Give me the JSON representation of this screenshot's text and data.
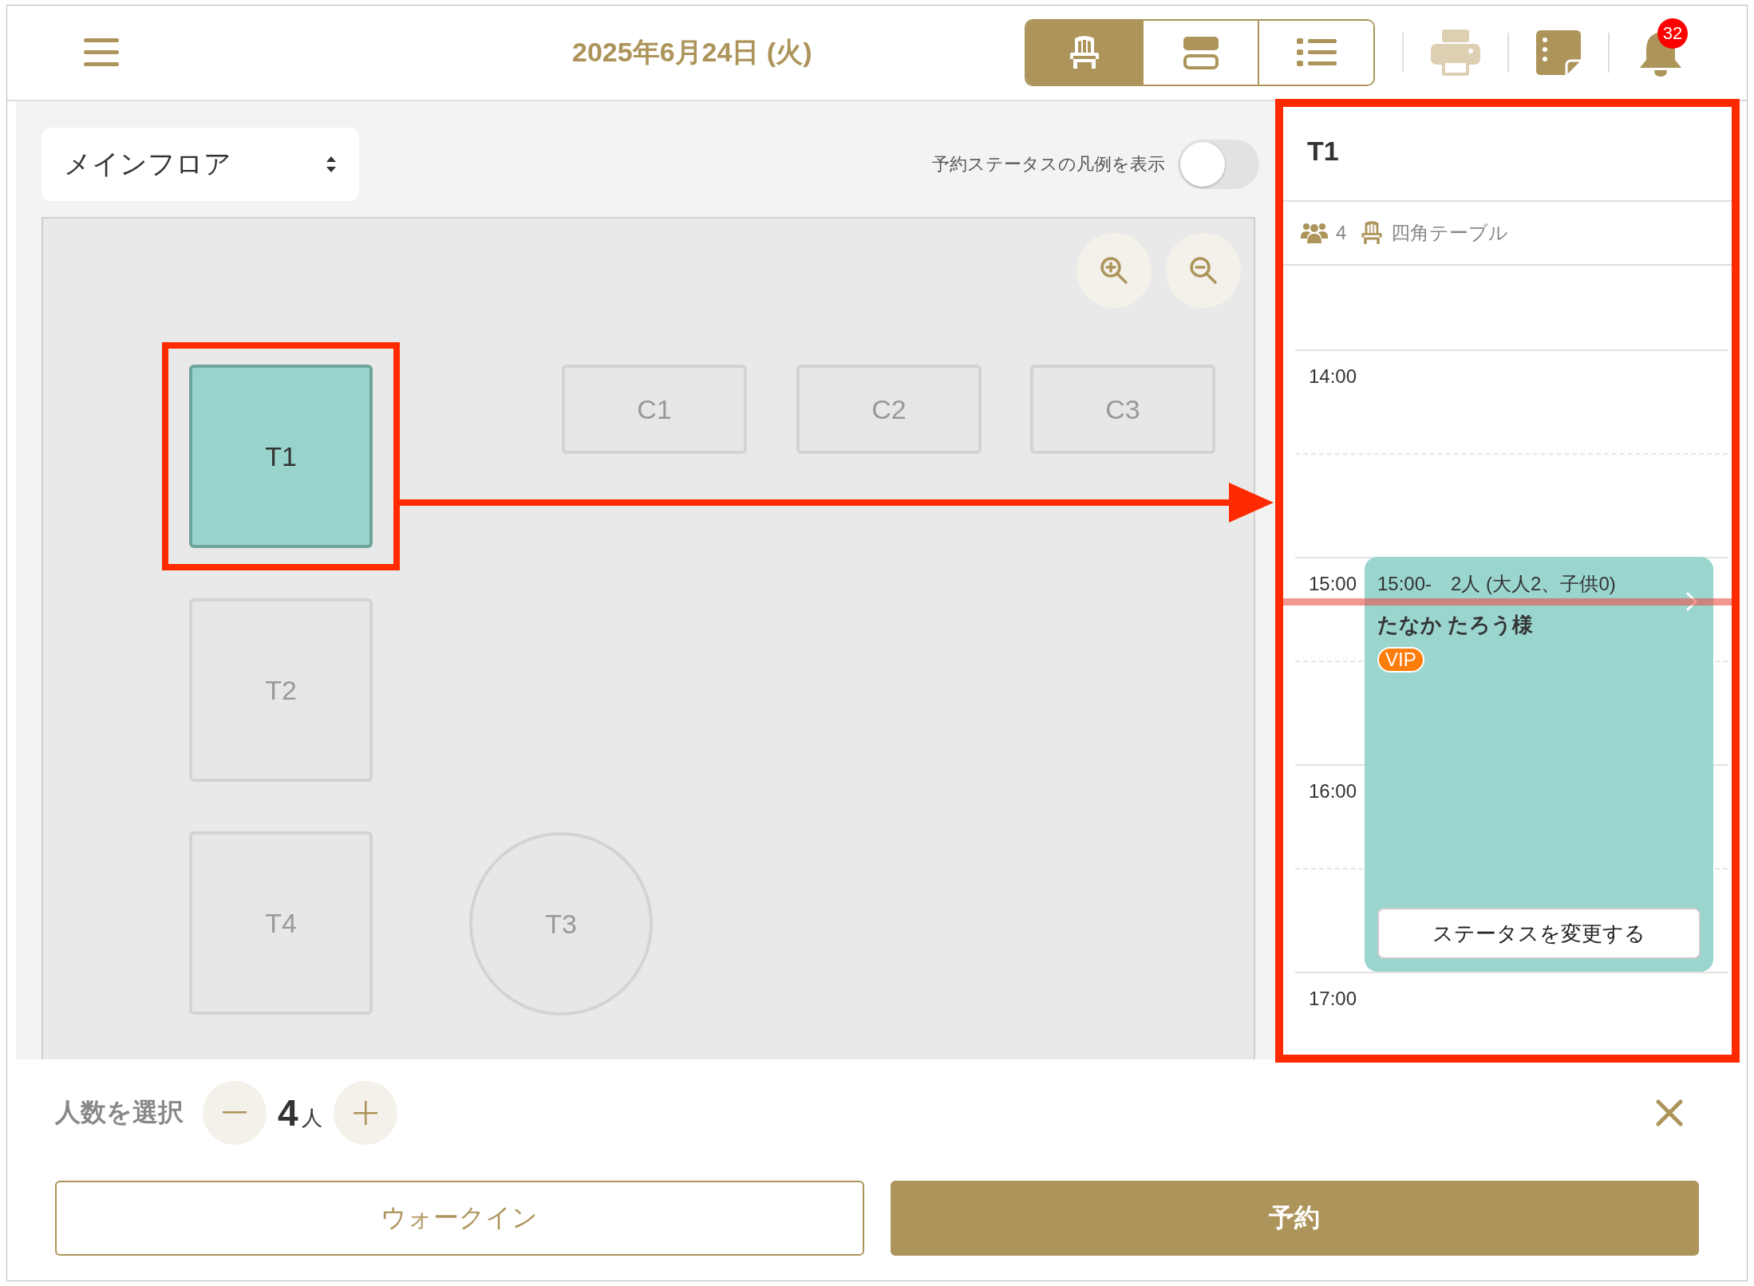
{
  "top_bar": {
    "date": "2025年6月24日 (火)",
    "view_tabs": [
      {
        "kind": "seat",
        "selected": true
      },
      {
        "kind": "rows",
        "selected": false
      },
      {
        "kind": "list",
        "selected": false
      }
    ],
    "notification_count": "32"
  },
  "floor": {
    "area": "メインフロア",
    "legend_toggle": {
      "label": "予約ステータスの凡例を表示",
      "on": false
    },
    "tables": [
      {
        "label": "T1",
        "kind": "square",
        "selected": true
      },
      {
        "label": "C1",
        "kind": "counter",
        "selected": false
      },
      {
        "label": "C2",
        "kind": "counter",
        "selected": false
      },
      {
        "label": "C3",
        "kind": "counter",
        "selected": false
      },
      {
        "label": "T2",
        "kind": "square",
        "selected": false
      },
      {
        "label": "T4",
        "kind": "square",
        "selected": false
      },
      {
        "label": "T3",
        "kind": "round",
        "selected": false
      }
    ]
  },
  "table_panel": {
    "title": "T1",
    "capacity": "4",
    "table_type": "四角テーブル",
    "times": [
      "14:00",
      "15:00",
      "16:00",
      "17:00"
    ],
    "reservation": {
      "summary": "15:00-　2人 (大人2、子供0)",
      "guest": "たなか たろう様",
      "tag": "VIP",
      "action": "ステータスを変更する"
    }
  },
  "party": {
    "label": "人数を選択",
    "value": "4",
    "unit": "人"
  },
  "actions": [
    {
      "label": "ウォークイン",
      "kind": "secondary"
    },
    {
      "label": "予約",
      "kind": "primary"
    }
  ]
}
